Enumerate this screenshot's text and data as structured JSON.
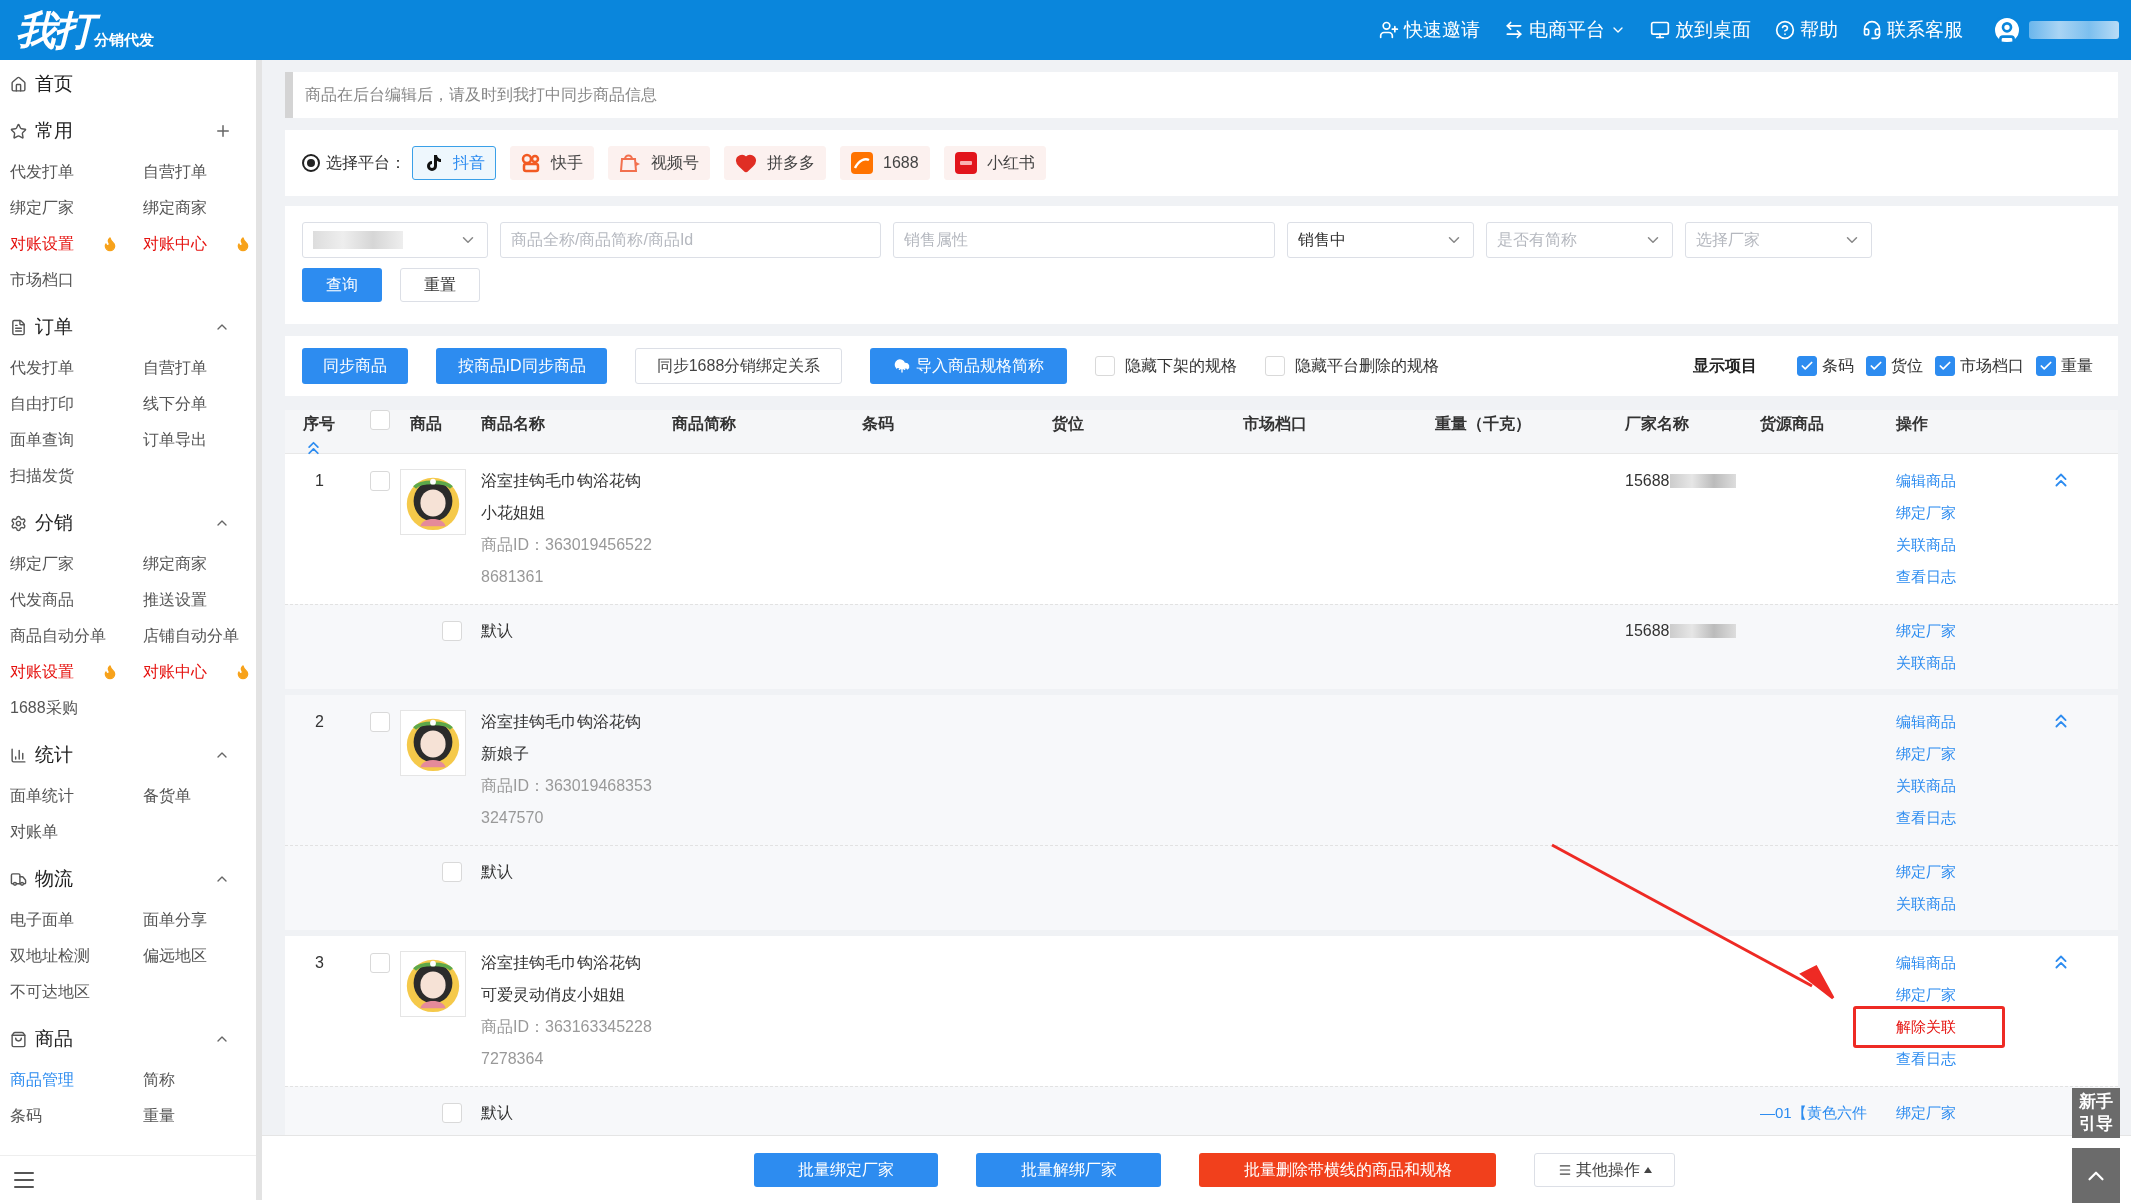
{
  "header": {
    "logo": "我打",
    "logo_sub": "分销代发",
    "actions": [
      {
        "label": "快速邀请",
        "kind": "invite"
      },
      {
        "label": "电商平台",
        "kind": "switch"
      },
      {
        "label": "放到桌面",
        "kind": "desktop"
      },
      {
        "label": "帮助",
        "kind": "help"
      },
      {
        "label": "联系客服",
        "kind": "service"
      }
    ]
  },
  "sidebar": {
    "home": "首页",
    "sections": [
      {
        "title": "常用",
        "kind": "favorites",
        "items": [
          {
            "label": "代发打单",
            "hot": false,
            "selected": false
          },
          {
            "label": "自营打单",
            "hot": false,
            "selected": false
          },
          {
            "label": "绑定厂家",
            "hot": false,
            "selected": false
          },
          {
            "label": "绑定商家",
            "hot": false,
            "selected": false
          },
          {
            "label": "对账设置",
            "hot": true,
            "selected": false
          },
          {
            "label": "对账中心",
            "hot": true,
            "selected": false
          },
          {
            "label": "市场档口",
            "hot": false,
            "selected": false
          }
        ]
      },
      {
        "title": "订单",
        "kind": "orders",
        "expanded": true,
        "items": [
          {
            "label": "代发打单",
            "hot": false,
            "selected": false
          },
          {
            "label": "自营打单",
            "hot": false,
            "selected": false
          },
          {
            "label": "自由打印",
            "hot": false,
            "selected": false
          },
          {
            "label": "线下分单",
            "hot": false,
            "selected": false
          },
          {
            "label": "面单查询",
            "hot": false,
            "selected": false
          },
          {
            "label": "订单导出",
            "hot": false,
            "selected": false
          },
          {
            "label": "扫描发货",
            "hot": false,
            "selected": false
          }
        ]
      },
      {
        "title": "分销",
        "kind": "distribution",
        "expanded": true,
        "items": [
          {
            "label": "绑定厂家",
            "hot": false,
            "selected": false
          },
          {
            "label": "绑定商家",
            "hot": false,
            "selected": false
          },
          {
            "label": "代发商品",
            "hot": false,
            "selected": false
          },
          {
            "label": "推送设置",
            "hot": false,
            "selected": false
          },
          {
            "label": "商品自动分单",
            "hot": false,
            "selected": false
          },
          {
            "label": "店铺自动分单",
            "hot": false,
            "selected": false
          },
          {
            "label": "对账设置",
            "hot": true,
            "selected": false
          },
          {
            "label": "对账中心",
            "hot": true,
            "selected": false
          },
          {
            "label": "1688采购",
            "hot": false,
            "selected": false
          }
        ]
      },
      {
        "title": "统计",
        "kind": "stats",
        "expanded": true,
        "items": [
          {
            "label": "面单统计",
            "hot": false,
            "selected": false
          },
          {
            "label": "备货单",
            "hot": false,
            "selected": false
          },
          {
            "label": "对账单",
            "hot": false,
            "selected": false
          }
        ]
      },
      {
        "title": "物流",
        "kind": "logistics",
        "expanded": true,
        "items": [
          {
            "label": "电子面单",
            "hot": false,
            "selected": false
          },
          {
            "label": "面单分享",
            "hot": false,
            "selected": false
          },
          {
            "label": "双地址检测",
            "hot": false,
            "selected": false
          },
          {
            "label": "偏远地区",
            "hot": false,
            "selected": false
          },
          {
            "label": "不可达地区",
            "hot": false,
            "selected": false
          }
        ]
      },
      {
        "title": "商品",
        "kind": "goods",
        "expanded": true,
        "items": [
          {
            "label": "商品管理",
            "hot": false,
            "selected": true
          },
          {
            "label": "简称",
            "hot": false,
            "selected": false
          },
          {
            "label": "条码",
            "hot": false,
            "selected": false
          },
          {
            "label": "重量",
            "hot": false,
            "selected": false
          }
        ]
      }
    ]
  },
  "notice": "商品在后台编辑后，请及时到我打中同步商品信息",
  "platform_picker": {
    "radio_checked": true,
    "label": "选择平台：",
    "platforms": [
      {
        "label": "抖音",
        "kind": "douyin",
        "selected": true
      },
      {
        "label": "快手",
        "kind": "kuaishou",
        "selected": false
      },
      {
        "label": "视频号",
        "kind": "channels",
        "selected": false
      },
      {
        "label": "拼多多",
        "kind": "pdd",
        "selected": false
      },
      {
        "label": "1688",
        "kind": "alibaba",
        "selected": false
      },
      {
        "label": "小红书",
        "kind": "xhs",
        "selected": false
      }
    ]
  },
  "filters": {
    "fields": [
      {
        "kind": "select",
        "redacted": true
      },
      {
        "kind": "input",
        "placeholder": "商品全称/商品简称/商品Id"
      },
      {
        "kind": "input",
        "placeholder": "销售属性"
      },
      {
        "kind": "select",
        "value": "销售中"
      },
      {
        "kind": "select",
        "placeholder": "是否有简称"
      },
      {
        "kind": "select",
        "placeholder": "选择厂家"
      }
    ],
    "buttons": [
      {
        "label": "查询",
        "primary": true
      },
      {
        "label": "重置",
        "primary": false
      }
    ]
  },
  "toolbar": {
    "buttons": [
      {
        "label": "同步商品",
        "kind": "sync",
        "primary": true
      },
      {
        "label": "按商品ID同步商品",
        "kind": "sync",
        "primary": true
      },
      {
        "label": "同步1688分销绑定关系",
        "kind": "sync",
        "primary": false
      },
      {
        "label": "导入商品规格简称",
        "kind": "import",
        "primary": true
      }
    ],
    "toggles": [
      {
        "label": "隐藏下架的规格",
        "checked": false
      },
      {
        "label": "隐藏平台删除的规格",
        "checked": false
      }
    ],
    "display_label": "显示项目",
    "display_items": [
      {
        "label": "条码",
        "checked": true
      },
      {
        "label": "货位",
        "checked": true
      },
      {
        "label": "市场档口",
        "checked": true
      },
      {
        "label": "重量",
        "checked": true
      }
    ]
  },
  "table": {
    "columns": [
      "序号",
      "商品",
      "商品名称",
      "商品简称",
      "条码",
      "货位",
      "市场档口",
      "重量（千克）",
      "厂家名称",
      "货源商品",
      "操作"
    ],
    "all_checked": false,
    "rows": [
      {
        "index": "1",
        "checked": false,
        "highlighted": false,
        "expanded": true,
        "name": "浴室挂钩毛巾钩浴花钩",
        "variant": "小花姐姐",
        "id_line": "商品ID：363019456522",
        "id_more": "8681361",
        "manufacturer": "15688",
        "actions": [
          {
            "label": "编辑商品",
            "kind": "link"
          },
          {
            "label": "绑定厂家",
            "kind": "link"
          },
          {
            "label": "关联商品",
            "kind": "link"
          },
          {
            "label": "查看日志",
            "kind": "link"
          }
        ],
        "specs": [
          {
            "name": "默认",
            "checked": false,
            "manufacturer": "15688",
            "actions": [
              {
                "label": "绑定厂家",
                "kind": "link"
              },
              {
                "label": "关联商品",
                "kind": "link"
              }
            ]
          }
        ]
      },
      {
        "index": "2",
        "checked": false,
        "highlighted": true,
        "expanded": true,
        "name": "浴室挂钩毛巾钩浴花钩",
        "variant": "新娘子",
        "id_line": "商品ID：363019468353",
        "id_more": "3247570",
        "actions": [
          {
            "label": "编辑商品",
            "kind": "link"
          },
          {
            "label": "绑定厂家",
            "kind": "link"
          },
          {
            "label": "关联商品",
            "kind": "link"
          },
          {
            "label": "查看日志",
            "kind": "link"
          }
        ],
        "specs": [
          {
            "name": "默认",
            "checked": false,
            "actions": [
              {
                "label": "绑定厂家",
                "kind": "link"
              },
              {
                "label": "关联商品",
                "kind": "link"
              }
            ]
          }
        ]
      },
      {
        "index": "3",
        "checked": false,
        "highlighted": false,
        "expanded": true,
        "name": "浴室挂钩毛巾钩浴花钩",
        "variant": "可爱灵动俏皮小姐姐",
        "id_line": "商品ID：363163345228",
        "id_more": "7278364",
        "actions": [
          {
            "label": "编辑商品",
            "kind": "link"
          },
          {
            "label": "绑定厂家",
            "kind": "link"
          },
          {
            "label": "解除关联",
            "kind": "danger"
          },
          {
            "label": "查看日志",
            "kind": "link"
          }
        ],
        "specs": [
          {
            "name": "默认",
            "checked": false,
            "source": "—01【黄色六件",
            "actions": [
              {
                "label": "绑定厂家",
                "kind": "link"
              }
            ]
          }
        ]
      }
    ]
  },
  "bottom_bar": {
    "buttons": [
      {
        "label": "批量绑定厂家",
        "kind": "primary"
      },
      {
        "label": "批量解绑厂家",
        "kind": "primary"
      },
      {
        "label": "批量删除带横线的商品和规格",
        "kind": "danger"
      },
      {
        "label": "其他操作",
        "kind": "menu"
      }
    ]
  },
  "guide_button": {
    "line1": "新手",
    "line2": "引导"
  }
}
